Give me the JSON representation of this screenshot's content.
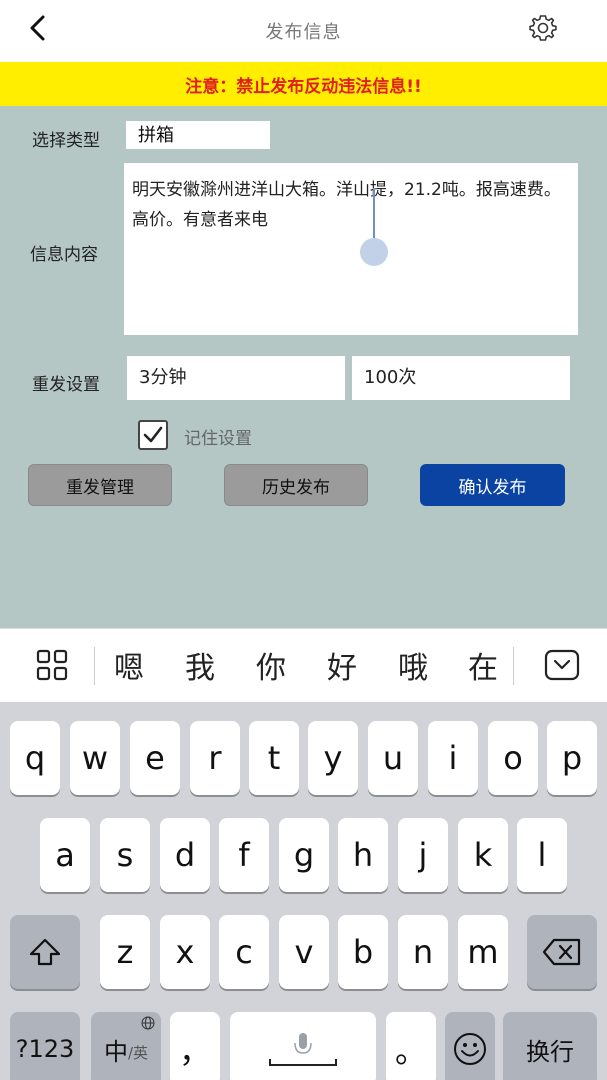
{
  "header": {
    "title": "发布信息"
  },
  "banner": {
    "text": "注意：禁止发布反动违法信息!!"
  },
  "form": {
    "type_label": "选择类型",
    "type_value": "拼箱",
    "content_label": "信息内容",
    "content_value": "明天安徽滁州进洋山大箱。洋山提，21.2吨。报高速费。高价。有意者来电",
    "repost_label": "重发设置",
    "interval_value": "3分钟",
    "count_value": "100次",
    "remember_label": "记住设置",
    "remember_checked": true
  },
  "buttons": {
    "repost_manage": "重发管理",
    "history": "历史发布",
    "confirm": "确认发布"
  },
  "candidates": [
    "嗯",
    "我",
    "你",
    "好",
    "哦",
    "在"
  ],
  "keyboard": {
    "row1": [
      "q",
      "w",
      "e",
      "r",
      "t",
      "y",
      "u",
      "i",
      "o",
      "p"
    ],
    "row2": [
      "a",
      "s",
      "d",
      "f",
      "g",
      "h",
      "j",
      "k",
      "l"
    ],
    "row3": [
      "z",
      "x",
      "c",
      "v",
      "b",
      "n",
      "m"
    ],
    "numbers_key": "?123",
    "lang_key_main": "中",
    "lang_key_sub": "/英",
    "comma_key": "，",
    "period_key": "。",
    "enter_key": "换行"
  },
  "colors": {
    "banner_bg": "#ffee00",
    "banner_text": "#e01e1e",
    "form_bg": "#b4c7c4",
    "confirm_bg": "#0a43a1"
  }
}
